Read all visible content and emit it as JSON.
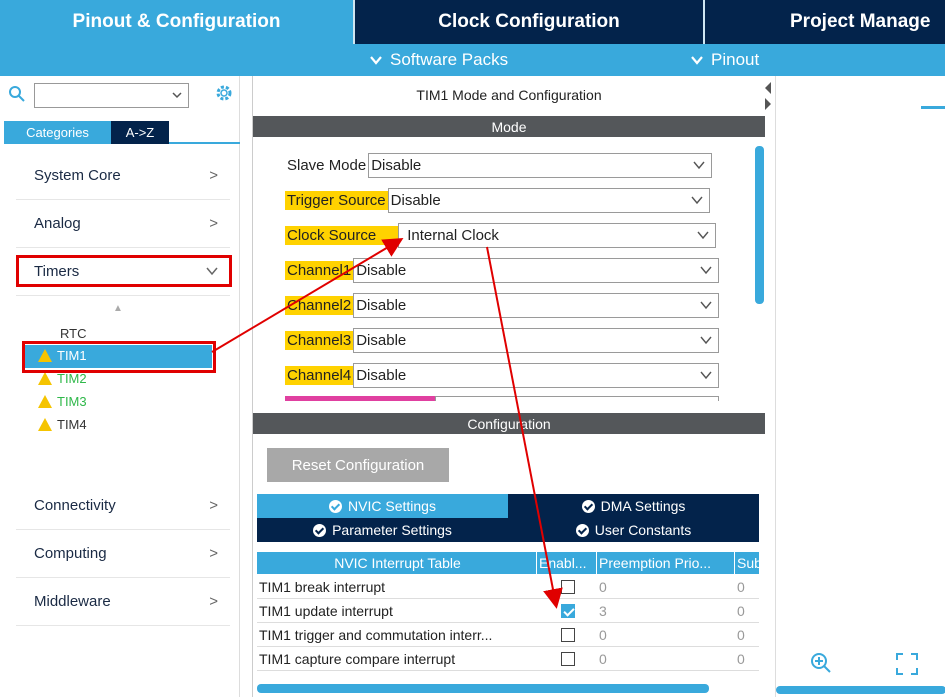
{
  "top_tabs": [
    "Pinout & Configuration",
    "Clock Configuration",
    "Project Manage"
  ],
  "sub_menu": {
    "software_packs": "Software Packs",
    "pinout": "Pinout"
  },
  "sidebar": {
    "category_tabs": [
      "Categories",
      "A->Z"
    ],
    "categories": [
      "System Core",
      "Analog",
      "Timers",
      "Connectivity",
      "Computing",
      "Middleware"
    ],
    "timers": [
      "RTC",
      "TIM1",
      "TIM2",
      "TIM3",
      "TIM4"
    ]
  },
  "mode_panel": {
    "title": "TIM1 Mode and Configuration",
    "mode_header": "Mode",
    "fields": [
      {
        "label": "Slave Mode",
        "value": "Disable"
      },
      {
        "label": "Trigger Source",
        "value": "Disable"
      },
      {
        "label": "Clock Source",
        "value": "Internal Clock"
      },
      {
        "label": "Channel1",
        "value": "Disable"
      },
      {
        "label": "Channel2",
        "value": "Disable"
      },
      {
        "label": "Channel3",
        "value": "Disable"
      },
      {
        "label": "Channel4",
        "value": "Disable"
      }
    ]
  },
  "config_panel": {
    "header": "Configuration",
    "reset_button": "Reset Configuration",
    "tabs": [
      "NVIC Settings",
      "DMA Settings",
      "Parameter Settings",
      "User Constants"
    ],
    "table_headers": [
      "NVIC Interrupt Table",
      "Enabl...",
      "Preemption Prio...",
      "Sub"
    ],
    "rows": [
      {
        "name": "TIM1 break interrupt",
        "enabled": false,
        "priority": "0",
        "sub": "0"
      },
      {
        "name": "TIM1 update interrupt",
        "enabled": true,
        "priority": "3",
        "sub": "0"
      },
      {
        "name": "TIM1 trigger and commutation interr...",
        "enabled": false,
        "priority": "0",
        "sub": "0"
      },
      {
        "name": "TIM1 capture compare interrupt",
        "enabled": false,
        "priority": "0",
        "sub": "0"
      }
    ]
  },
  "colors": {
    "dark_navy": "#03234b",
    "accent_blue": "#39a9dc",
    "highlight_yellow": "#ffd200",
    "annotation_red": "#e00000"
  }
}
